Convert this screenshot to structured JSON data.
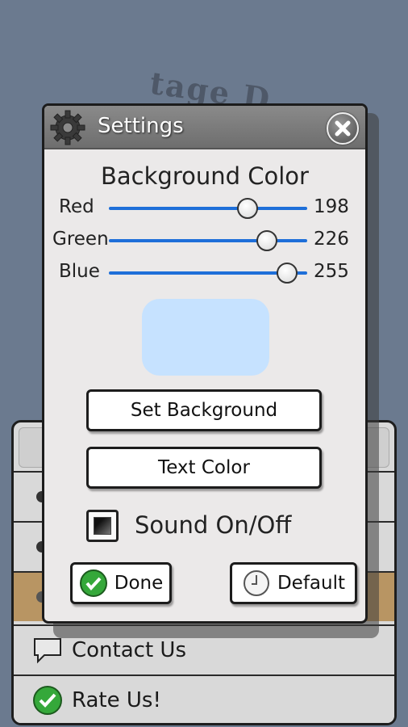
{
  "background": {
    "title_partial": "tage D",
    "menu": {
      "items": [
        {
          "label": ""
        },
        {
          "label": ""
        },
        {
          "label": ""
        },
        {
          "label": "Contact Us",
          "icon": "speech-bubble-icon"
        },
        {
          "label": "Rate Us!",
          "icon": "checkmark-icon"
        }
      ]
    }
  },
  "dialog": {
    "title": "Settings",
    "title_icon": "gear-icon",
    "close_icon": "close-icon",
    "section_title": "Background Color",
    "sliders": [
      {
        "label": "Red",
        "value": "198",
        "fraction": 0.776
      },
      {
        "label": "Green",
        "value": "226",
        "fraction": 0.886
      },
      {
        "label": "Blue",
        "value": "255",
        "fraction": 1.0
      }
    ],
    "preview_color": "#c6e2ff",
    "accent_color": "#1e6fd9",
    "set_background_label": "Set Background",
    "text_color_label": "Text Color",
    "sound_label": "Sound On/Off",
    "sound_checked": true,
    "done_label": "Done",
    "default_label": "Default"
  }
}
